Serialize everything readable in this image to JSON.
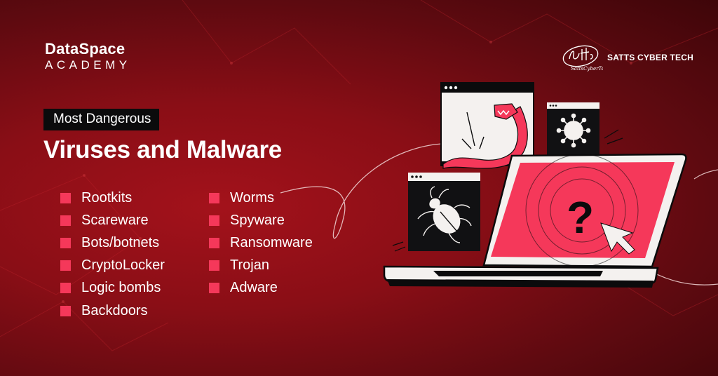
{
  "brand": {
    "left_logo": {
      "line1": "DataSpace",
      "line2": "ACADEMY"
    },
    "right_logo": {
      "name": "SATTS CYBER TECH",
      "script_mark": "Satts"
    }
  },
  "headline": {
    "tag": "Most Dangerous",
    "title": "Viruses and Malware"
  },
  "list": {
    "column1": [
      "Rootkits",
      "Scareware",
      "Bots/botnets",
      "CryptoLocker",
      "Logic bombs",
      "Backdoors"
    ],
    "column2": [
      "Worms",
      "Spyware",
      "Ransomware",
      "Trojan",
      "Adware"
    ]
  },
  "illustration": {
    "icons": [
      "worm-icon",
      "virus-icon",
      "bug-icon",
      "question-mark-icon",
      "cursor-arrow-icon"
    ],
    "screen_symbol": "?"
  },
  "colors": {
    "background": "#8a0e16",
    "accent": "#f5385a",
    "dark": "#0b0b0c",
    "light": "#f4f1ef"
  }
}
